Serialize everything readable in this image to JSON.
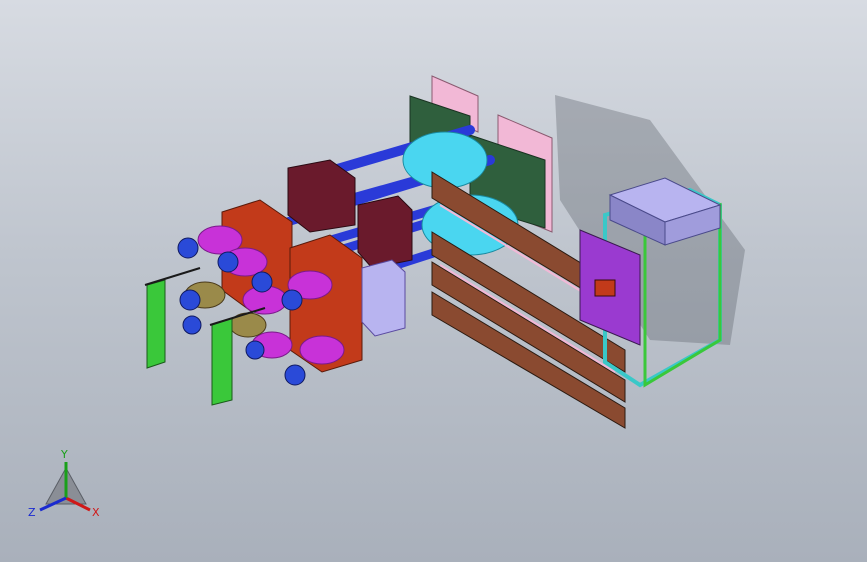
{
  "viewport": {
    "background_top": "#d7dbe2",
    "background_bottom": "#a9b0bb"
  },
  "triad": {
    "x_label": "X",
    "y_label": "Y",
    "z_label": "Z",
    "x_color": "#d01818",
    "y_color": "#1aa01a",
    "z_color": "#1a2ad0"
  },
  "colors": {
    "dark_green": "#2f5f3d",
    "pink": "#f2b8d6",
    "blue_rod": "#2a3ad8",
    "maroon": "#6a1a2c",
    "red_plate": "#c23a1a",
    "magenta": "#c832d8",
    "cyan": "#4ad6f0",
    "green": "#3ac83a",
    "brown": "#8a4a30",
    "lavender": "#b8b4f0",
    "purple": "#9a3ad0"
  }
}
